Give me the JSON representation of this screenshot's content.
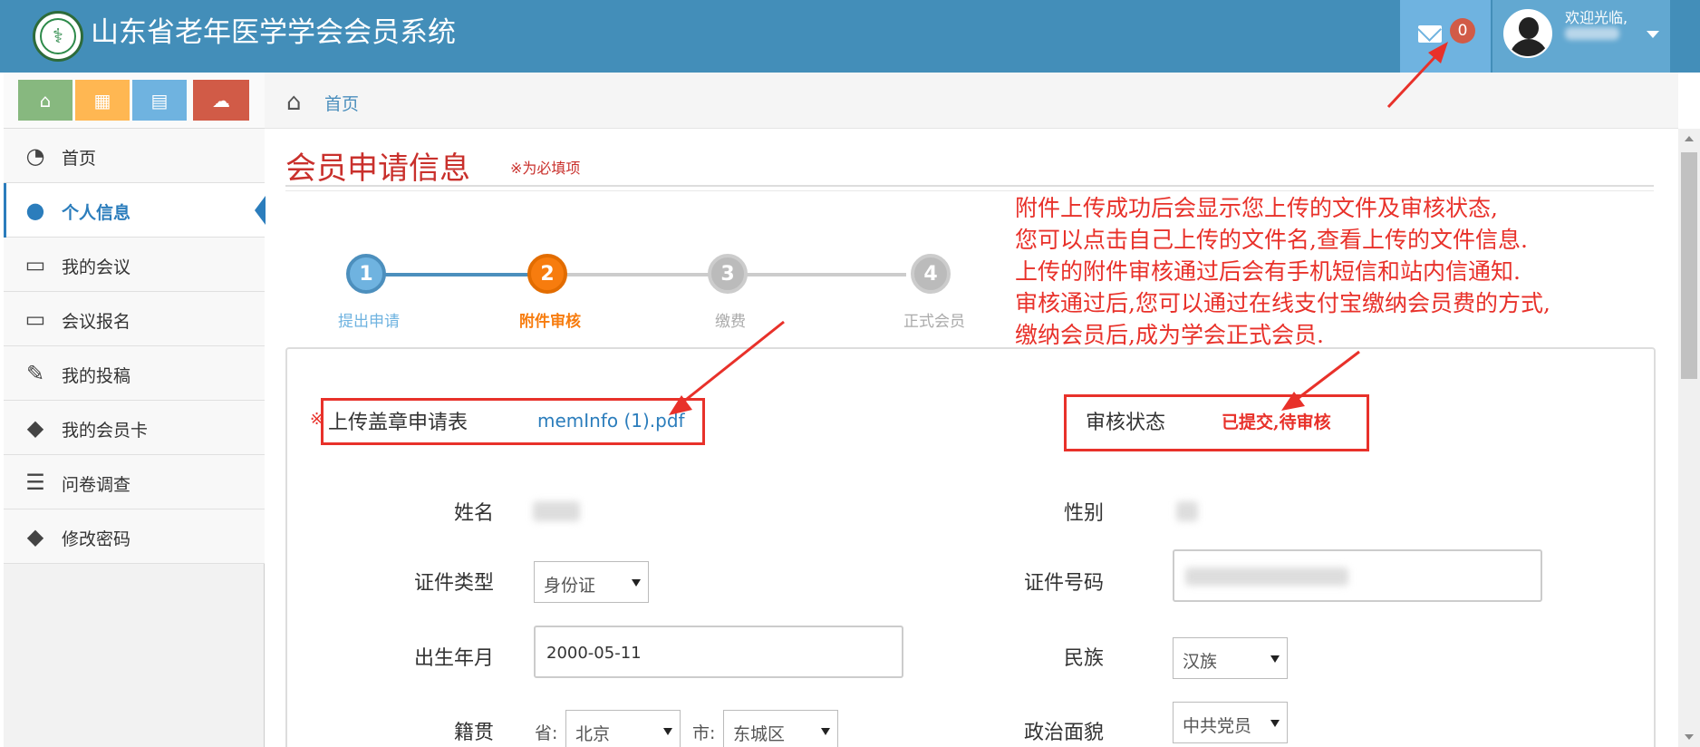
{
  "header": {
    "title": "山东省老年医学学会会员系统",
    "message_count": "0",
    "welcome": "欢迎光临,"
  },
  "shortcuts": [
    "home-icon",
    "calendar-icon",
    "chart-icon",
    "cloud-download-icon"
  ],
  "sidebar": {
    "items": [
      {
        "label": "首页",
        "icon": "dashboard-icon"
      },
      {
        "label": "个人信息",
        "icon": "user-icon",
        "active": true
      },
      {
        "label": "我的会议",
        "icon": "desktop-icon"
      },
      {
        "label": "会议报名",
        "icon": "desktop-icon"
      },
      {
        "label": "我的投稿",
        "icon": "edit-icon"
      },
      {
        "label": "我的会员卡",
        "icon": "tag-icon"
      },
      {
        "label": "问卷调查",
        "icon": "list-icon"
      },
      {
        "label": "修改密码",
        "icon": "tag-icon"
      }
    ]
  },
  "breadcrumb": {
    "home": "首页"
  },
  "main": {
    "title": "会员申请信息",
    "required_note": "※为必填项",
    "annotation": [
      "附件上传成功后会显示您上传的文件及审核状态,",
      "您可以点击自己上传的文件名,查看上传的文件信息.",
      "上传的附件审核通过后会有手机短信和站内信通知.",
      "审核通过后,您可以通过在线支付宝缴纳会员费的方式,",
      "缴纳会员后,成为学会正式会员."
    ],
    "steps": [
      {
        "num": "1",
        "label": "提出申请"
      },
      {
        "num": "2",
        "label": "附件审核"
      },
      {
        "num": "3",
        "label": "缴费"
      },
      {
        "num": "4",
        "label": "正式会员"
      }
    ]
  },
  "form": {
    "required_mark": "※",
    "upload_label": "上传盖章申请表",
    "upload_file": "memInfo (1).pdf",
    "status_label": "审核状态",
    "status_value": "已提交,待审核",
    "name_label": "姓名",
    "gender_label": "性别",
    "id_type_label": "证件类型",
    "id_type_value": "身份证",
    "id_number_label": "证件号码",
    "birth_label": "出生年月",
    "birth_value": "2000-05-11",
    "ethnicity_label": "民族",
    "ethnicity_value": "汉族",
    "native_label": "籍贯",
    "province_label": "省:",
    "province_value": "北京",
    "city_label": "市:",
    "city_value": "东城区",
    "political_label": "政治面貌",
    "political_value": "中共党员"
  },
  "colors": {
    "header_bg": "#438eb9",
    "accent": "#2b7dbc",
    "annotation_red": "#e8312a",
    "step_active": "#f77c0e"
  }
}
